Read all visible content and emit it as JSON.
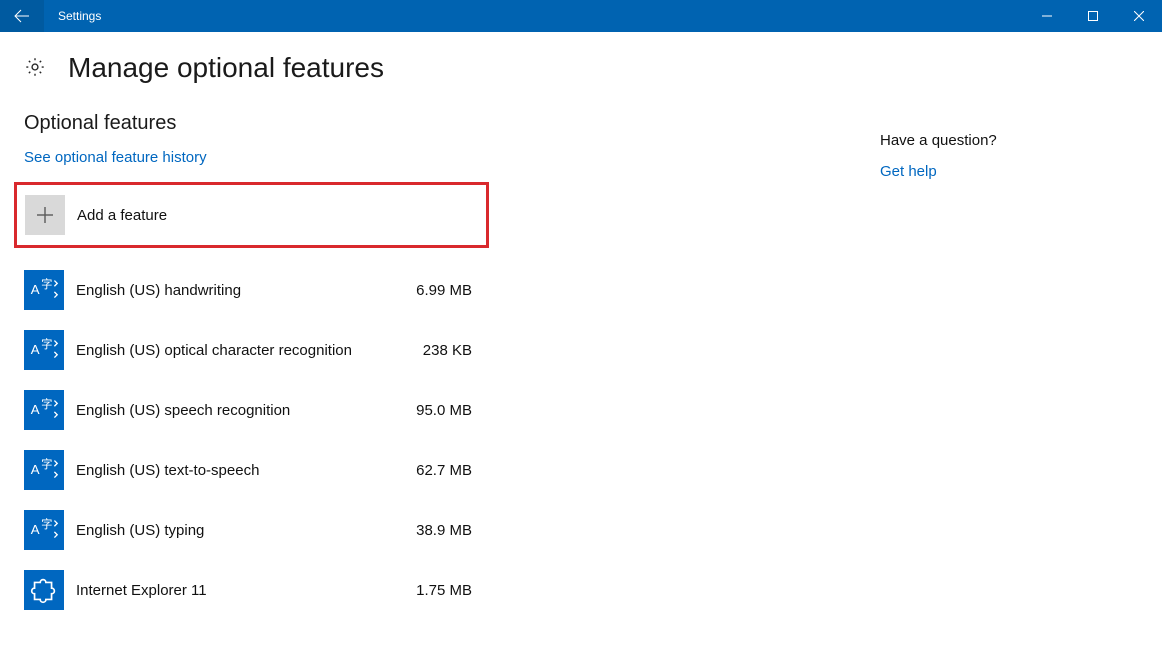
{
  "titlebar": {
    "title": "Settings"
  },
  "page": {
    "heading": "Manage optional features"
  },
  "section": {
    "heading": "Optional features",
    "history_link": "See optional feature history",
    "add_label": "Add a feature"
  },
  "features": [
    {
      "name": "English (US) handwriting",
      "size": "6.99 MB",
      "icon": "lang"
    },
    {
      "name": "English (US) optical character recognition",
      "size": "238 KB",
      "icon": "lang"
    },
    {
      "name": "English (US) speech recognition",
      "size": "95.0 MB",
      "icon": "lang"
    },
    {
      "name": "English (US) text-to-speech",
      "size": "62.7 MB",
      "icon": "lang"
    },
    {
      "name": "English (US) typing",
      "size": "38.9 MB",
      "icon": "lang"
    },
    {
      "name": "Internet Explorer 11",
      "size": "1.75 MB",
      "icon": "puzzle"
    }
  ],
  "help": {
    "question": "Have a question?",
    "link": "Get help"
  }
}
